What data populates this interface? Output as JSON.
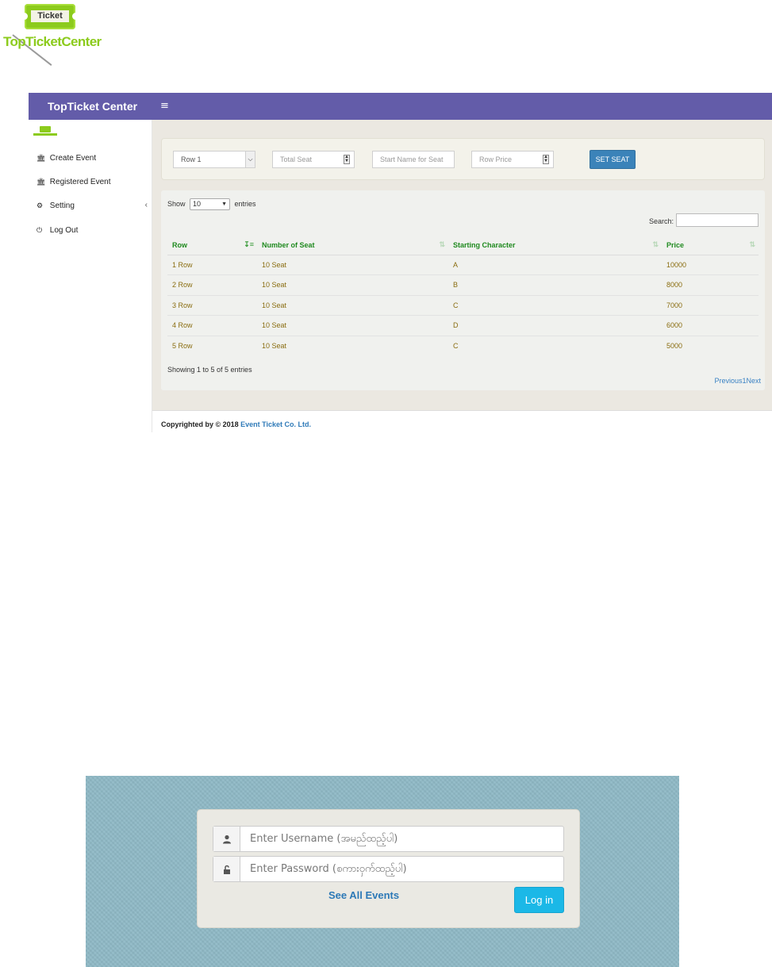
{
  "logo": {
    "badge_text": "Ticket",
    "name": "TopTicketCenter"
  },
  "admin": {
    "brand": "TopTicket Center",
    "menu_toggle": "≡",
    "sidebar": {
      "items": [
        {
          "label": "Create Event",
          "icon": "bank-icon"
        },
        {
          "label": "Registered Event",
          "icon": "bank-icon"
        },
        {
          "label": "Setting",
          "icon": "cogs-icon"
        },
        {
          "label": "Log Out",
          "icon": "power-icon"
        }
      ]
    },
    "seat_form": {
      "row_select_value": "Row 1",
      "total_seat_placeholder": "Total Seat",
      "start_name_placeholder": "Start Name for Seat",
      "row_price_placeholder": "Row Price",
      "set_seat_label": "SET SEAT"
    },
    "table": {
      "show_label": "Show",
      "entries_label": "entries",
      "page_length": "10",
      "search_label": "Search:",
      "columns": [
        "Row",
        "Number of Seat",
        "Starting Character",
        "Price"
      ],
      "rows": [
        [
          "1 Row",
          "10 Seat",
          "A",
          "10000"
        ],
        [
          "2 Row",
          "10 Seat",
          "B",
          "8000"
        ],
        [
          "3 Row",
          "10 Seat",
          "C",
          "7000"
        ],
        [
          "4 Row",
          "10 Seat",
          "D",
          "6000"
        ],
        [
          "5 Row",
          "10 Seat",
          "C",
          "5000"
        ]
      ],
      "info": "Showing 1 to 5 of 5 entries",
      "pager": {
        "previous": "Previous",
        "current": "1",
        "next": "Next"
      }
    },
    "footer": {
      "prefix": "Copyrighted by © 2018",
      "company": "Event Ticket Co. Ltd."
    }
  },
  "login": {
    "username_placeholder": "Enter Username (အမည်ထည့်ပါ)",
    "password_placeholder": "Enter Password (စကားဝှက်ထည့်ပါ)",
    "see_all_label": "See All Events",
    "login_label": "Log in"
  },
  "colors": {
    "topbar": "#635ca9",
    "logo_green": "#8ccb1d",
    "table_header": "#1f8a1f",
    "table_cell": "#8a6d10",
    "set_seat_button": "#3b83b9",
    "login_button": "#1bb8e7",
    "login_background": "#8fb9c6"
  }
}
